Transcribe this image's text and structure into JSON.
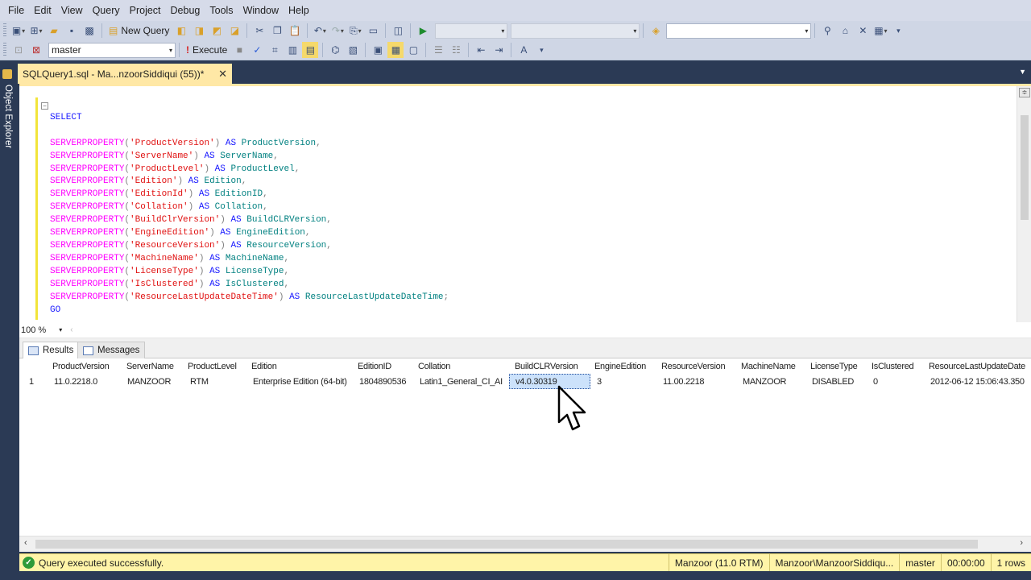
{
  "menubar": {
    "items": [
      "File",
      "Edit",
      "View",
      "Query",
      "Project",
      "Debug",
      "Tools",
      "Window",
      "Help"
    ]
  },
  "toolbar1": {
    "new_query_label": "New Query"
  },
  "toolbar2": {
    "database": "master",
    "execute_label": "Execute"
  },
  "side_panel": {
    "label": "Object Explorer"
  },
  "document_tab": {
    "title": "SQLQuery1.sql - Ma...nzoorSiddiqui (55))*",
    "close": "✕"
  },
  "editor": {
    "select_kw": "SELECT",
    "lines": [
      {
        "fn": "SERVERPROPERTY",
        "arg": "'ProductVersion'",
        "alias": "ProductVersion",
        "end": ","
      },
      {
        "fn": "SERVERPROPERTY",
        "arg": "'ServerName'",
        "alias": "ServerName",
        "end": ","
      },
      {
        "fn": "SERVERPROPERTY",
        "arg": "'ProductLevel'",
        "alias": "ProductLevel",
        "end": ","
      },
      {
        "fn": "SERVERPROPERTY",
        "arg": "'Edition'",
        "alias": "Edition",
        "end": ","
      },
      {
        "fn": "SERVERPROPERTY",
        "arg": "'EditionId'",
        "alias": "EditionID",
        "end": ","
      },
      {
        "fn": "SERVERPROPERTY",
        "arg": "'Collation'",
        "alias": "Collation",
        "end": ","
      },
      {
        "fn": "SERVERPROPERTY",
        "arg": "'BuildClrVersion'",
        "alias": "BuildCLRVersion",
        "end": ","
      },
      {
        "fn": "SERVERPROPERTY",
        "arg": "'EngineEdition'",
        "alias": "EngineEdition",
        "end": ","
      },
      {
        "fn": "SERVERPROPERTY",
        "arg": "'ResourceVersion'",
        "alias": "ResourceVersion",
        "end": ","
      },
      {
        "fn": "SERVERPROPERTY",
        "arg": "'MachineName'",
        "alias": "MachineName",
        "end": ","
      },
      {
        "fn": "SERVERPROPERTY",
        "arg": "'LicenseType'",
        "alias": "LicenseType",
        "end": ","
      },
      {
        "fn": "SERVERPROPERTY",
        "arg": "'IsClustered'",
        "alias": "IsClustered",
        "end": ","
      },
      {
        "fn": "SERVERPROPERTY",
        "arg": "'ResourceLastUpdateDateTime'",
        "alias": "ResourceLastUpdateDateTime",
        "end": ";"
      }
    ],
    "as_kw": "AS",
    "go_kw": "GO"
  },
  "zoom": {
    "level": "100 %"
  },
  "results": {
    "tabs": [
      "Results",
      "Messages"
    ],
    "columns": [
      "ProductVersion",
      "ServerName",
      "ProductLevel",
      "Edition",
      "EditionID",
      "Collation",
      "BuildCLRVersion",
      "EngineEdition",
      "ResourceVersion",
      "MachineName",
      "LicenseType",
      "IsClustered",
      "ResourceLastUpdateDate"
    ],
    "row": [
      "1",
      "11.0.2218.0",
      "MANZOOR",
      "RTM",
      "Enterprise Edition (64-bit)",
      "1804890536",
      "Latin1_General_CI_AI",
      "v4.0.30319",
      "3",
      "11.00.2218",
      "MANZOOR",
      "DISABLED",
      "0",
      "2012-06-12 15:06:43.350"
    ]
  },
  "statusbar": {
    "message": "Query executed successfully.",
    "server": "Manzoor (11.0 RTM)",
    "user": "Manzoor\\ManzoorSiddiqu...",
    "database": "master",
    "elapsed": "00:00:00",
    "rows": "1 rows"
  },
  "colors": {
    "tab_active": "#ffe8a6",
    "statusbar": "#fff4a8",
    "chrome": "#2b3a55",
    "keyword": "#1a1aff",
    "function": "#ff00ff",
    "string": "#e01010"
  }
}
